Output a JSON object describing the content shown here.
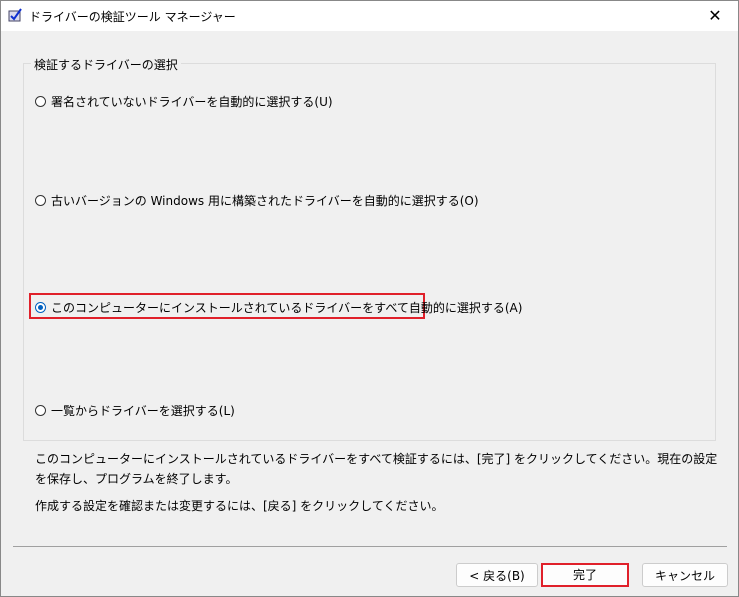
{
  "window": {
    "title": "ドライバーの検証ツール マネージャー",
    "close": "✕"
  },
  "group": {
    "label": "検証するドライバーの選択"
  },
  "options": [
    {
      "label": "署名されていないドライバーを自動的に選択する(U)",
      "selected": false
    },
    {
      "label": "古いバージョンの Windows 用に構築されたドライバーを自動的に選択する(O)",
      "selected": false
    },
    {
      "label": "このコンピューターにインストールされているドライバーをすべて自動的に選択する(A)",
      "selected": true
    },
    {
      "label": "一覧からドライバーを選択する(L)",
      "selected": false
    }
  ],
  "info": {
    "line1": "このコンピューターにインストールされているドライバーをすべて検証するには、[完了] をクリックしてください。現在の設定を保存し、プログラムを終了します。",
    "line2": "作成する設定を確認または変更するには、[戻る] をクリックしてください。"
  },
  "buttons": {
    "back": "< 戻る(B)",
    "finish": "完了",
    "cancel": "キャンセル"
  }
}
